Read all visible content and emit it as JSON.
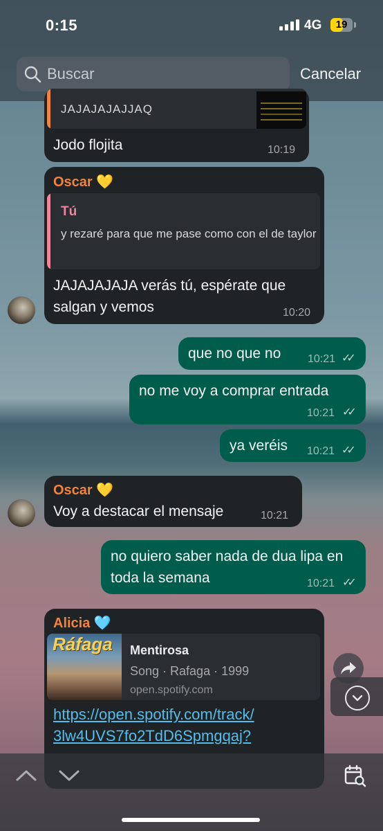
{
  "status_bar": {
    "time": "0:15",
    "network": "4G",
    "battery": "19",
    "battery_level": 0.19
  },
  "search": {
    "placeholder": "Buscar",
    "cancel_label": "Cancelar"
  },
  "messages": [
    {
      "id": "m0",
      "quote_text": "JAJAJAJAJJAQ",
      "text": "Jodo flojita",
      "time": "10:19"
    },
    {
      "id": "m1",
      "sender": "Oscar 💛",
      "quote_sender": "Tú",
      "quote_text": "y rezaré para que me pase como con el de taylor",
      "text": "JAJAJAJAJA verás tú, espérate que salgan y vemos",
      "time": "10:20"
    },
    {
      "id": "m2",
      "text": "que no que no",
      "time": "10:21"
    },
    {
      "id": "m3",
      "text": "no me voy a comprar entrada",
      "time": "10:21"
    },
    {
      "id": "m4",
      "text": "ya veréis",
      "time": "10:21"
    },
    {
      "id": "m5",
      "sender": "Oscar 💛",
      "text": "Voy a destacar el mensaje",
      "time": "10:21"
    },
    {
      "id": "m6",
      "text": "no quiero saber nada de dua lipa en toda la semana",
      "time": "10:21"
    },
    {
      "id": "m7",
      "sender": "Alicia 🩵",
      "link_preview": {
        "cover_text": "Ráfaga",
        "title": "Mentirosa",
        "subtitle": "Song · Rafaga · 1999",
        "domain": "open.spotify.com"
      },
      "link_lines": [
        "https://open.spotify.com/track/",
        "3lw4UVS7fo2TdD6Spmgqaj?"
      ]
    }
  ],
  "colors": {
    "incoming": "#1f2326",
    "outgoing": "#005c4b",
    "sender_name": "#f0843e",
    "quote_you": "#f0859a",
    "link": "#53bdeb"
  }
}
